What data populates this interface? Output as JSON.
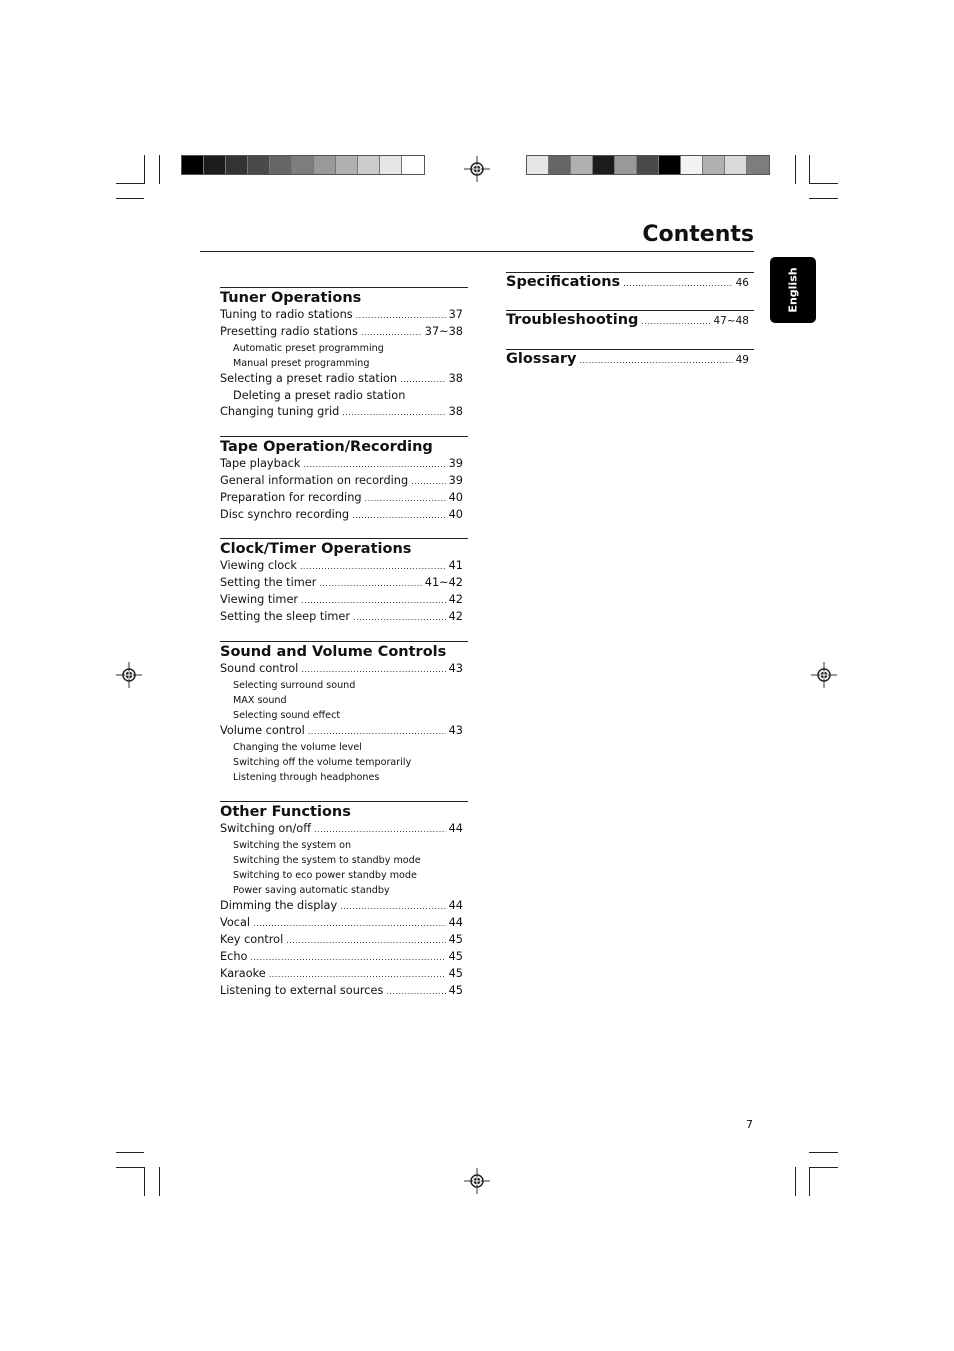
{
  "page": {
    "title": "Contents",
    "page_number": "7",
    "language_tab": "English"
  },
  "color_bar_left": [
    "#000000",
    "#1c1c1c",
    "#333333",
    "#4a4a4a",
    "#666666",
    "#7d7d7d",
    "#999999",
    "#b0b0b0",
    "#cccccc",
    "#e6e6e6",
    "#ffffff"
  ],
  "color_bar_right": [
    "#e6e6e6",
    "#666666",
    "#b0b0b0",
    "#1c1c1c",
    "#999999",
    "#4a4a4a",
    "#000000",
    "#f2f2f2",
    "#b0b0b0",
    "#d9d9d9",
    "#7d7d7d"
  ],
  "sections": [
    {
      "heading": "Tuner Operations",
      "items": [
        {
          "type": "entry",
          "label": "Tuning to radio stations",
          "page": "37"
        },
        {
          "type": "entry",
          "label": "Presetting radio stations",
          "page": "37~38"
        },
        {
          "type": "sub",
          "label": "Automatic preset programming"
        },
        {
          "type": "sub",
          "label": "Manual preset programming"
        },
        {
          "type": "entry",
          "label": "Selecting a preset radio station",
          "page": "38"
        },
        {
          "type": "subbig",
          "label": "Deleting a preset radio station"
        },
        {
          "type": "entry",
          "label": "Changing tuning grid",
          "page": "38"
        }
      ]
    },
    {
      "heading": "Tape Operation/Recording",
      "items": [
        {
          "type": "entry",
          "label": "Tape playback",
          "page": "39"
        },
        {
          "type": "entry",
          "label": "General information on recording",
          "page": "39"
        },
        {
          "type": "entry",
          "label": "Preparation for recording",
          "page": "40"
        },
        {
          "type": "entry",
          "label": "Disc synchro recording",
          "page": "40"
        }
      ]
    },
    {
      "heading": "Clock/Timer Operations",
      "items": [
        {
          "type": "entry",
          "label": "Viewing clock",
          "page": "41"
        },
        {
          "type": "entry",
          "label": "Setting the timer",
          "page": "41~42"
        },
        {
          "type": "entry",
          "label": "Viewing timer",
          "page": "42"
        },
        {
          "type": "entry",
          "label": "Setting the sleep timer",
          "page": "42"
        }
      ]
    },
    {
      "heading": "Sound and Volume Controls",
      "items": [
        {
          "type": "entry",
          "label": "Sound control",
          "page": "43"
        },
        {
          "type": "sub",
          "label": "Selecting surround sound"
        },
        {
          "type": "sub",
          "label": "MAX sound"
        },
        {
          "type": "sub",
          "label": "Selecting sound effect"
        },
        {
          "type": "entry",
          "label": "Volume control",
          "page": "43"
        },
        {
          "type": "sub",
          "label": "Changing the volume level"
        },
        {
          "type": "sub",
          "label": "Switching off the volume temporarily"
        },
        {
          "type": "sub",
          "label": "Listening through headphones"
        }
      ]
    },
    {
      "heading": "Other Functions",
      "items": [
        {
          "type": "entry",
          "label": "Switching on/off",
          "page": "44"
        },
        {
          "type": "sub",
          "label": "Switching the system on"
        },
        {
          "type": "sub",
          "label": "Switching the system to standby mode"
        },
        {
          "type": "sub",
          "label": "Switching to eco power standby mode"
        },
        {
          "type": "sub",
          "label": "Power saving automatic standby"
        },
        {
          "type": "entry",
          "label": "Dimming the display",
          "page": "44"
        },
        {
          "type": "entry",
          "label": "Vocal",
          "page": "44"
        },
        {
          "type": "entry",
          "label": "Key control",
          "page": "45"
        },
        {
          "type": "entry",
          "label": "Echo",
          "page": "45"
        },
        {
          "type": "entry",
          "label": "Karaoke",
          "page": "45"
        },
        {
          "type": "entry",
          "label": "Listening to external sources",
          "page": "45"
        }
      ]
    }
  ],
  "right_sections": [
    {
      "label": "Specifications",
      "page": "46"
    },
    {
      "label": "Troubleshooting",
      "page": "47~48"
    },
    {
      "label": "Glossary",
      "page": "49"
    }
  ]
}
